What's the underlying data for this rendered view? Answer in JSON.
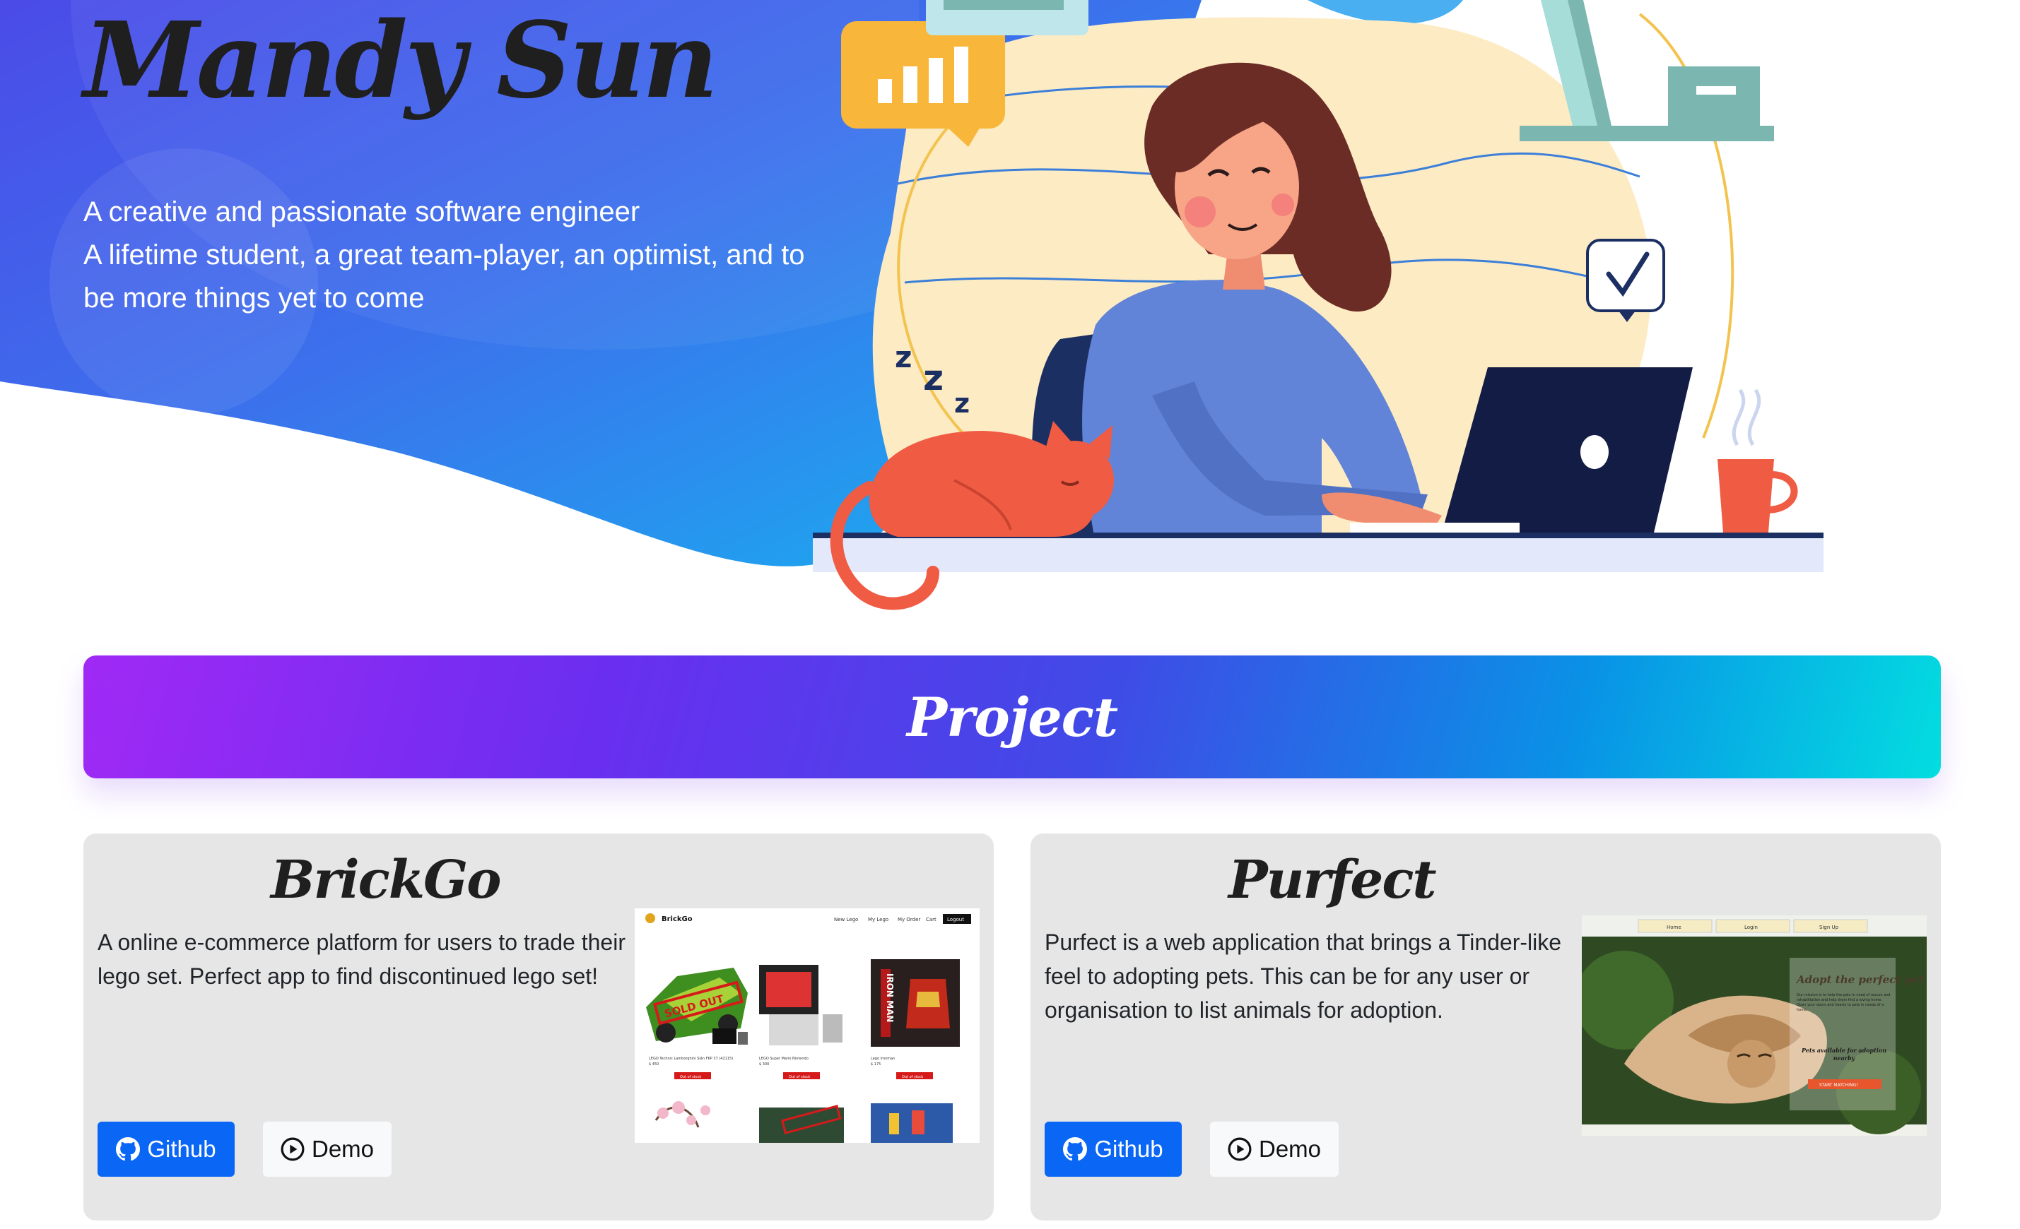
{
  "hero": {
    "name": "Mandy Sun",
    "tagline_line1": "A creative and passionate software engineer",
    "tagline_line2": "A lifetime student, a great team-player, an optimist, and to be more things yet to come"
  },
  "banner": {
    "title": "Project"
  },
  "projects": [
    {
      "title": "BrickGo",
      "description": "A online e-commerce platform for users to trade their lego set. Perfect app to find discontinued lego set!",
      "github_label": "Github",
      "demo_label": "Demo",
      "screenshot": {
        "brand": "BrickGo",
        "nav": [
          "New Lego",
          "My Lego",
          "My Order",
          "Cart",
          "Logout"
        ],
        "stamp_sold": "SOLD OUT",
        "product_1": "LEGO Technic Lamborghini Sián FKP 37 (42115)",
        "product_2": "LEGO Super Mario Nintendo",
        "product_3": "Lego Ironman",
        "box_text": "IRON MAN",
        "price_1": "$ 450",
        "price_2": "$ 300",
        "price_3": "$ 175",
        "status": "Out of stock"
      }
    },
    {
      "title": "Purfect",
      "description": "Purfect is a web application that brings a Tinder-like feel to adopting pets. This can be for any user or organisation to list animals for adoption.",
      "github_label": "Github",
      "demo_label": "Demo",
      "screenshot": {
        "nav": [
          "Home",
          "Login",
          "Sign Up"
        ],
        "heading": "Adopt the perfect pet",
        "body": "Our mission is to help the pets in need of rescue and rehabilitation and help them find a loving home. Open your doors and hearts to pets in needs of a home.",
        "sub": "Pets available for adoption nearby",
        "cta": "START MATCHING!"
      }
    }
  ],
  "colors": {
    "accent_github": "#0a66f5",
    "hero_gradient_start": "#4b4be8",
    "hero_gradient_end": "#16b3f0",
    "banner_gradient_start": "#a029f5",
    "banner_gradient_end": "#03dde0"
  },
  "icons": [
    "github-icon",
    "play-circle-icon",
    "bar-chart-icon",
    "checkmark-icon"
  ]
}
